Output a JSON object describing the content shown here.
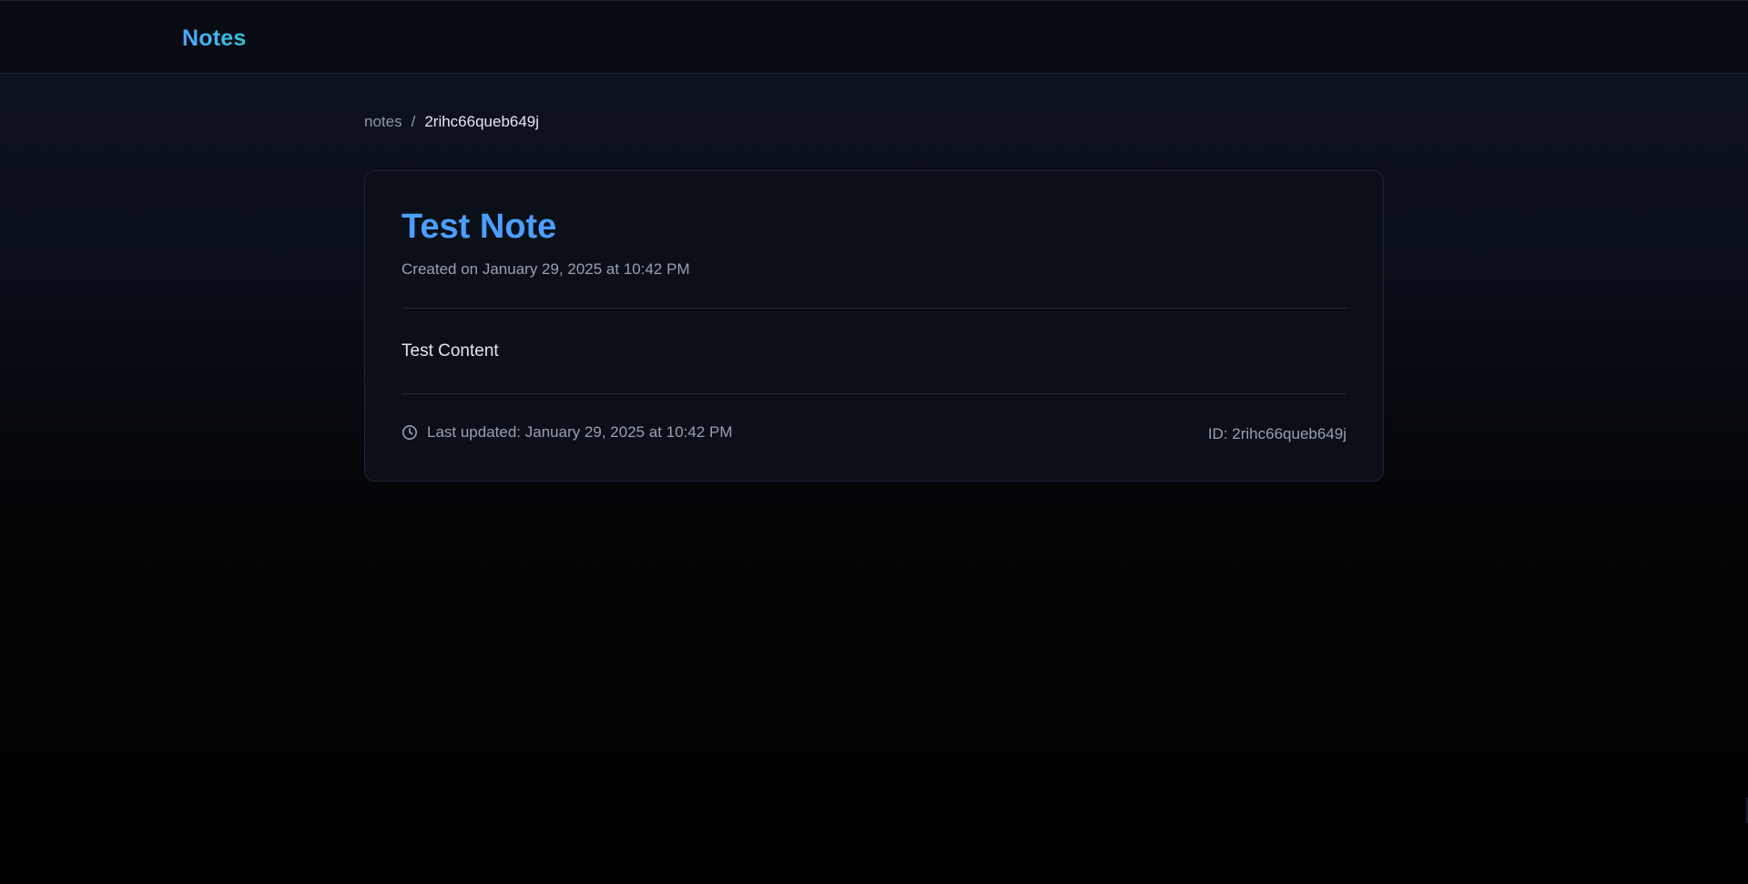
{
  "app": {
    "brand": "Notes"
  },
  "breadcrumb": {
    "root": "notes",
    "separator": "/",
    "current": "2rihc66queb649j"
  },
  "note": {
    "title": "Test Note",
    "created": "Created on January 29, 2025 at 10:42 PM",
    "content": "Test Content",
    "last_updated": "Last updated: January 29, 2025 at 10:42 PM",
    "id_label": "ID: 2rihc66queb649j",
    "clock_icon": "clock-icon"
  },
  "colors": {
    "accent_title": "#4a9fff",
    "brand_gradient_start": "#4aa8ff",
    "brand_gradient_end": "#2fc6d8",
    "card_background": "#0b0f18",
    "muted_text": "#98a0ae"
  }
}
